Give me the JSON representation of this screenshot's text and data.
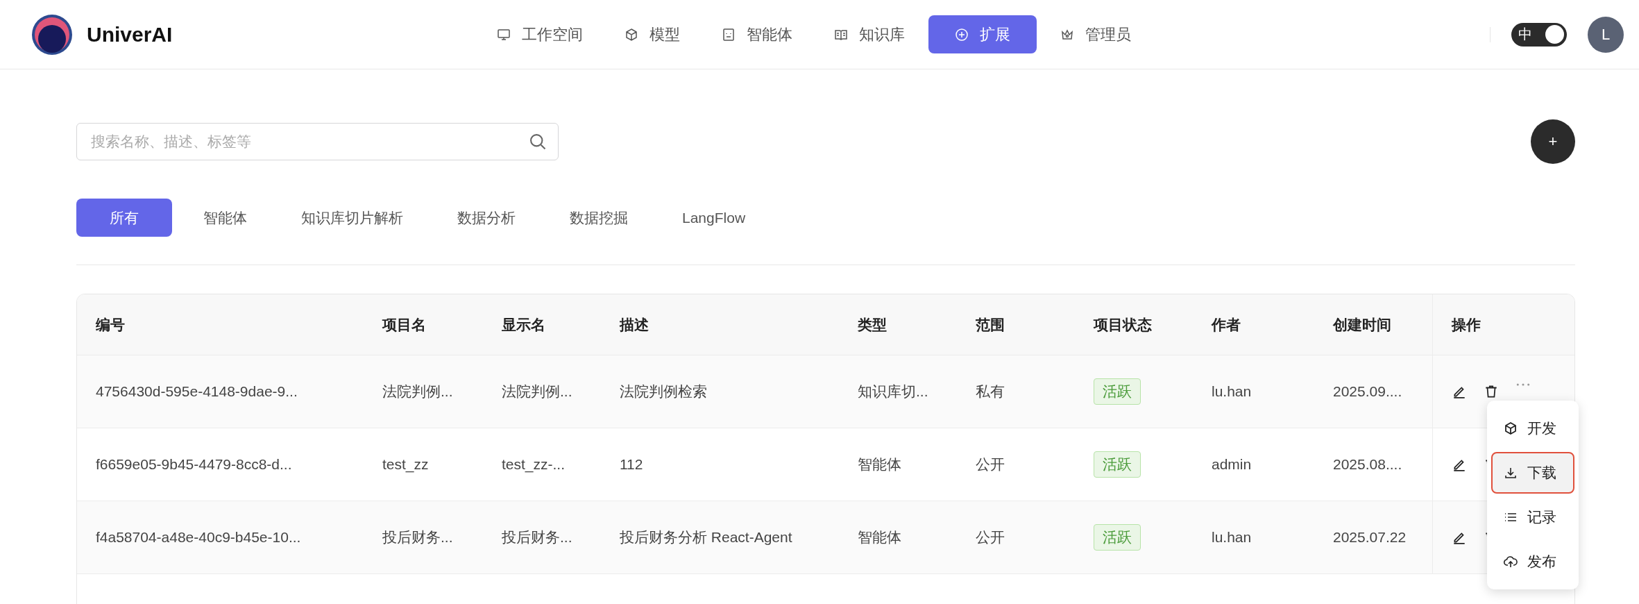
{
  "brand": {
    "name": "UniverAI"
  },
  "nav": [
    {
      "label": "工作空间",
      "selected": false
    },
    {
      "label": "模型",
      "selected": false
    },
    {
      "label": "智能体",
      "selected": false
    },
    {
      "label": "知识库",
      "selected": false
    },
    {
      "label": "扩展",
      "selected": true
    },
    {
      "label": "管理员",
      "selected": false
    }
  ],
  "language_toggle": {
    "label": "中",
    "on": true
  },
  "avatar": {
    "initial": "L"
  },
  "search": {
    "placeholder": "搜索名称、描述、标签等"
  },
  "add_button": {
    "label": "+"
  },
  "tabs": [
    {
      "label": "所有",
      "selected": true
    },
    {
      "label": "智能体",
      "selected": false
    },
    {
      "label": "知识库切片解析",
      "selected": false
    },
    {
      "label": "数据分析",
      "selected": false
    },
    {
      "label": "数据挖掘",
      "selected": false
    },
    {
      "label": "LangFlow",
      "selected": false
    }
  ],
  "table": {
    "columns": [
      "编号",
      "项目名",
      "显示名",
      "描述",
      "类型",
      "范围",
      "项目状态",
      "作者",
      "创建时间",
      "操作"
    ],
    "rows": [
      {
        "id": "4756430d-595e-4148-9dae-9...",
        "project": "法院判例...",
        "display": "法院判例...",
        "description": "法院判例检索",
        "type": "知识库切...",
        "scope": "私有",
        "status": "活跃",
        "author": "lu.han",
        "created": "2025.09...."
      },
      {
        "id": "f6659e05-9b45-4479-8cc8-d...",
        "project": "test_zz",
        "display": "test_zz-...",
        "description": "112",
        "type": "智能体",
        "scope": "公开",
        "status": "活跃",
        "author": "admin",
        "created": "2025.08...."
      },
      {
        "id": "f4a58704-a48e-40c9-b45e-10...",
        "project": "投后财务...",
        "display": "投后财务...",
        "description": "投后财务分析 React-Agent",
        "type": "智能体",
        "scope": "公开",
        "status": "活跃",
        "author": "lu.han",
        "created": "2025.07.22"
      }
    ]
  },
  "row_menu": {
    "items": [
      {
        "label": "开发",
        "selected": false
      },
      {
        "label": "下载",
        "selected": true
      },
      {
        "label": "记录",
        "selected": false
      },
      {
        "label": "发布",
        "selected": false
      }
    ]
  }
}
